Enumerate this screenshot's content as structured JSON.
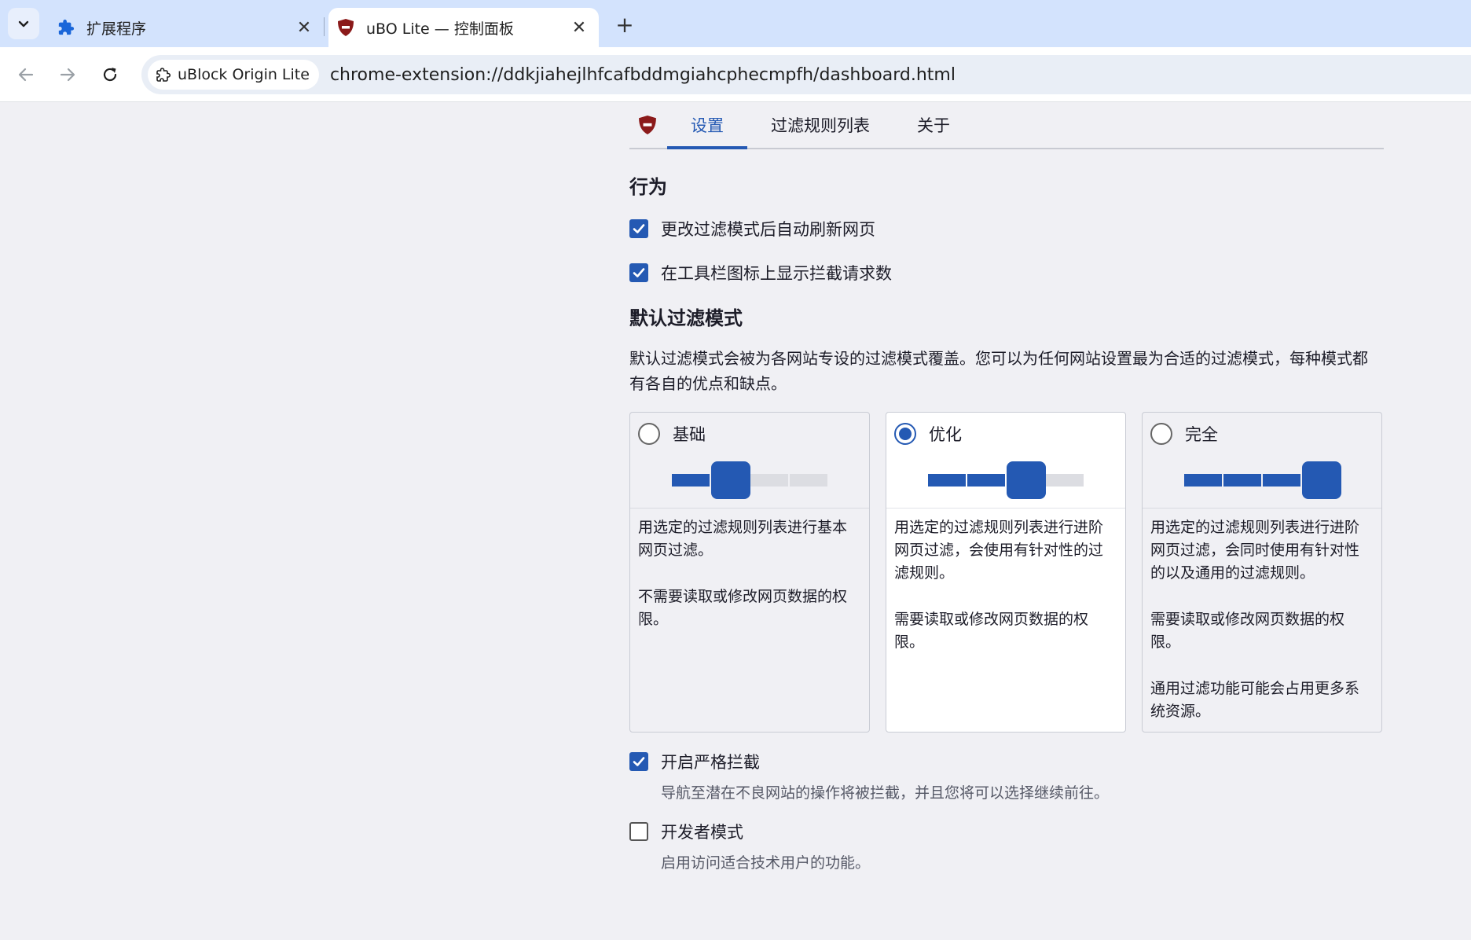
{
  "browser": {
    "tabs": [
      {
        "title": "扩展程序",
        "icon": "puzzle-icon",
        "active": false
      },
      {
        "title": "uBO Lite — 控制面板",
        "icon": "ubo-shield-icon",
        "active": true
      }
    ],
    "new_tab_label": "+",
    "omnibox": {
      "chip_label": "uBlock Origin Lite",
      "url": "chrome-extension://ddkjiahejlhfcafbddmgiahcphecmpfh/dashboard.html"
    }
  },
  "page": {
    "nav_tabs": [
      {
        "label": "设置",
        "selected": true
      },
      {
        "label": "过滤规则列表",
        "selected": false
      },
      {
        "label": "关于",
        "selected": false
      }
    ],
    "behavior": {
      "heading": "行为",
      "options": [
        {
          "label": "更改过滤模式后自动刷新网页",
          "checked": true
        },
        {
          "label": "在工具栏图标上显示拦截请求数",
          "checked": true
        }
      ]
    },
    "filter_mode": {
      "heading": "默认过滤模式",
      "description": "默认过滤模式会被为各网站专设的过滤模式覆盖。您可以为任何网站设置最为合适的过滤模式，每种模式都有各自的优点和缺点。",
      "modes": [
        {
          "name": "基础",
          "selected": false,
          "level": 2,
          "lines": [
            "用选定的过滤规则列表进行基本网页过滤。",
            "不需要读取或修改网页数据的权限。"
          ]
        },
        {
          "name": "优化",
          "selected": true,
          "level": 3,
          "lines": [
            "用选定的过滤规则列表进行进阶网页过滤，会使用有针对性的过滤规则。",
            "需要读取或修改网页数据的权限。"
          ]
        },
        {
          "name": "完全",
          "selected": false,
          "level": 4,
          "lines": [
            "用选定的过滤规则列表进行进阶网页过滤，会同时使用有针对性的以及通用的过滤规则。",
            "需要读取或修改网页数据的权限。",
            "通用过滤功能可能会占用更多系统资源。"
          ]
        }
      ]
    },
    "strict_block": {
      "label": "开启严格拦截",
      "checked": true,
      "description": "导航至潜在不良网站的操作将被拦截，并且您将可以选择继续前往。"
    },
    "developer_mode": {
      "label": "开发者模式",
      "checked": false,
      "description": "启用访问适合技术用户的功能。"
    }
  },
  "colors": {
    "accent": "#2459b3",
    "tabstrip": "#d3e3fd",
    "page_bg": "#f0f0f4",
    "ubo_red": "#8b1a1a"
  }
}
